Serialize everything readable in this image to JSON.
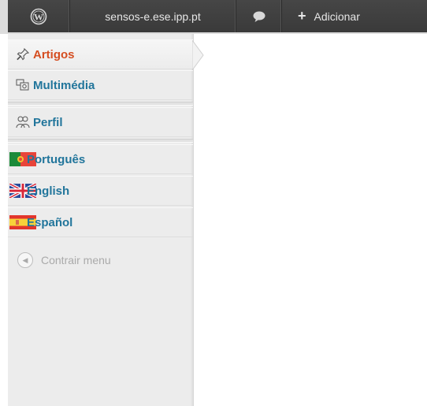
{
  "admin_bar": {
    "logo_icon": "wordpress-logo-icon",
    "site_name": "sensos-e.ese.ipp.pt",
    "comments_icon": "comment-bubble-icon",
    "new_icon": "plus-icon",
    "new_label": "Adicionar"
  },
  "menu": {
    "items": [
      {
        "label": "Artigos",
        "icon": "pushpin-icon",
        "current": true
      },
      {
        "label": "Multimédia",
        "icon": "media-icon"
      },
      {
        "label": "Perfil",
        "icon": "users-icon"
      },
      {
        "label": "Português",
        "icon": "flag-portugal-icon"
      },
      {
        "label": "English",
        "icon": "flag-uk-icon"
      },
      {
        "label": "Español",
        "icon": "flag-spain-icon"
      }
    ],
    "collapse_label": "Contrair menu"
  },
  "colors": {
    "accent_current": "#d54e21",
    "link": "#21759b",
    "adminbar": "#464646"
  }
}
